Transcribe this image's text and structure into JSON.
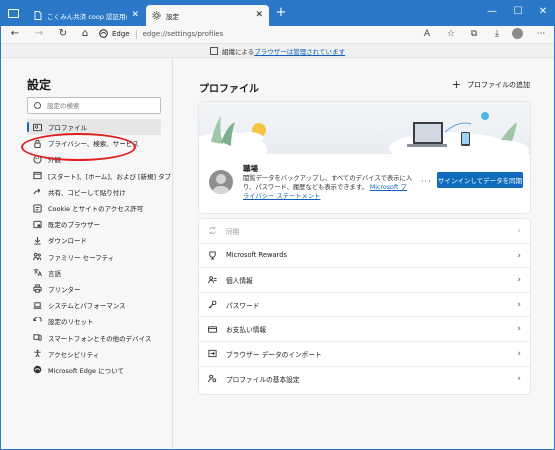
{
  "tabs": [
    {
      "label": "こくみん共済 coop 認証用のログイン",
      "close": "✕",
      "active": false
    },
    {
      "label": "設定",
      "close": "✕",
      "active": true
    }
  ],
  "new_tab": "+",
  "window_controls": {
    "minimize": "—",
    "maximize": "☐",
    "close": "✕"
  },
  "address": {
    "brand": "Edge",
    "url": "edge://settings/profiles"
  },
  "managed_bar": {
    "prefix": "組織による",
    "link": "ブラウザーは管理されています"
  },
  "sidebar": {
    "title": "設定",
    "search_placeholder": "設定の検索",
    "items": [
      {
        "label": "プロファイル",
        "icon": "person-icon"
      },
      {
        "label": "プライバシー、検索、サービス",
        "icon": "lock-icon"
      },
      {
        "label": "外観",
        "icon": "palette-icon"
      },
      {
        "label": "[スタート]、[ホーム]、および [新規] タブ",
        "icon": "home-icon"
      },
      {
        "label": "共有、コピーして貼り付け",
        "icon": "share-icon"
      },
      {
        "label": "Cookie とサイトのアクセス許可",
        "icon": "site-permissions-icon"
      },
      {
        "label": "既定のブラウザー",
        "icon": "browser-icon"
      },
      {
        "label": "ダウンロード",
        "icon": "download-icon"
      },
      {
        "label": "ファミリー セーフティ",
        "icon": "family-icon"
      },
      {
        "label": "言語",
        "icon": "language-icon"
      },
      {
        "label": "プリンター",
        "icon": "printer-icon"
      },
      {
        "label": "システムとパフォーマンス",
        "icon": "laptop-icon"
      },
      {
        "label": "設定のリセット",
        "icon": "reset-icon"
      },
      {
        "label": "スマートフォンとその他のデバイス",
        "icon": "phone-icon"
      },
      {
        "label": "アクセシビリティ",
        "icon": "accessibility-icon"
      },
      {
        "label": "Microsoft Edge について",
        "icon": "edge-icon"
      }
    ]
  },
  "main": {
    "title": "プロファイル",
    "add_profile": "プロファイルの追加",
    "profile": {
      "name": "職場",
      "desc": "閲覧データをバックアップし、すべてのデバイスで表示に入り、パスワード、履歴なども表示できます。",
      "link": "Microsoft プライバシー ステートメント",
      "more": "···",
      "sync_button": "サインインしてデータを同期"
    },
    "rows": [
      {
        "label": "同期",
        "icon": "sync-icon",
        "disabled": true
      },
      {
        "label": "Microsoft Rewards",
        "icon": "rewards-icon",
        "disabled": false
      },
      {
        "label": "個人情報",
        "icon": "personal-info-icon",
        "disabled": false
      },
      {
        "label": "パスワード",
        "icon": "key-icon",
        "disabled": false
      },
      {
        "label": "お支払い情報",
        "icon": "credit-card-icon",
        "disabled": false
      },
      {
        "label": "ブラウザー データのインポート",
        "icon": "import-icon",
        "disabled": false
      },
      {
        "label": "プロファイルの基本設定",
        "icon": "profile-settings-icon",
        "disabled": false
      }
    ]
  },
  "colors": {
    "titlebar": "#2b78c8",
    "accent": "#0f6cbd",
    "annotation": "#e01e1e"
  }
}
